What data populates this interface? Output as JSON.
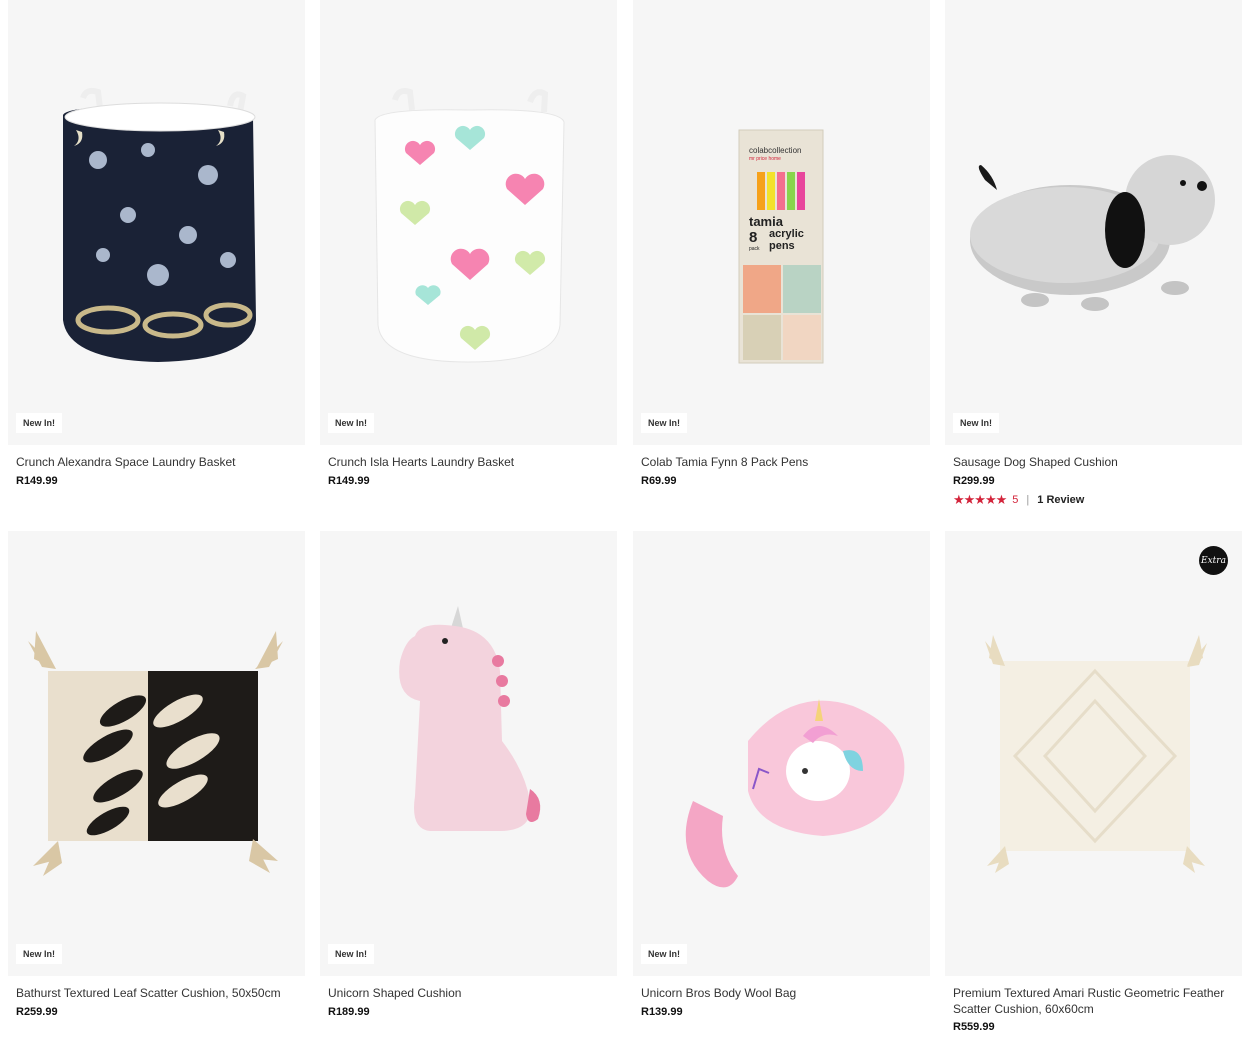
{
  "products": [
    {
      "name": "Crunch Alexandra Space Laundry Basket",
      "price": "R149.99",
      "badge": "New In!"
    },
    {
      "name": "Crunch Isla Hearts Laundry Basket",
      "price": "R149.99",
      "badge": "New In!"
    },
    {
      "name": "Colab Tamia Fynn 8 Pack Pens",
      "price": "R69.99",
      "badge": "New In!",
      "pack_text": {
        "brand": "colabcollection",
        "store": "mr price home",
        "line1": "tamia",
        "count": "8",
        "unit": "pack",
        "line2": "acrylic",
        "line3": "pens"
      }
    },
    {
      "name": "Sausage Dog Shaped Cushion",
      "price": "R299.99",
      "badge": "New In!",
      "stars": "★★★★★",
      "rating": "5",
      "separator": "|",
      "reviews": "1 Review"
    },
    {
      "name": "Bathurst Textured Leaf Scatter Cushion, 50x50cm",
      "price": "R259.99",
      "badge": "New In!"
    },
    {
      "name": "Unicorn Shaped Cushion",
      "price": "R189.99",
      "badge": "New In!"
    },
    {
      "name": "Unicorn Bros Body Wool Bag",
      "price": "R139.99",
      "badge": "New In!"
    },
    {
      "name": "Premium Textured Amari Rustic Geometric Feather Scatter Cushion, 60x60cm",
      "price": "R559.99",
      "extra": "Extra"
    }
  ],
  "colors": {
    "accent_red": "#d3243b",
    "tile_bg": "#f6f6f6",
    "badge_bg": "#ffffff"
  }
}
